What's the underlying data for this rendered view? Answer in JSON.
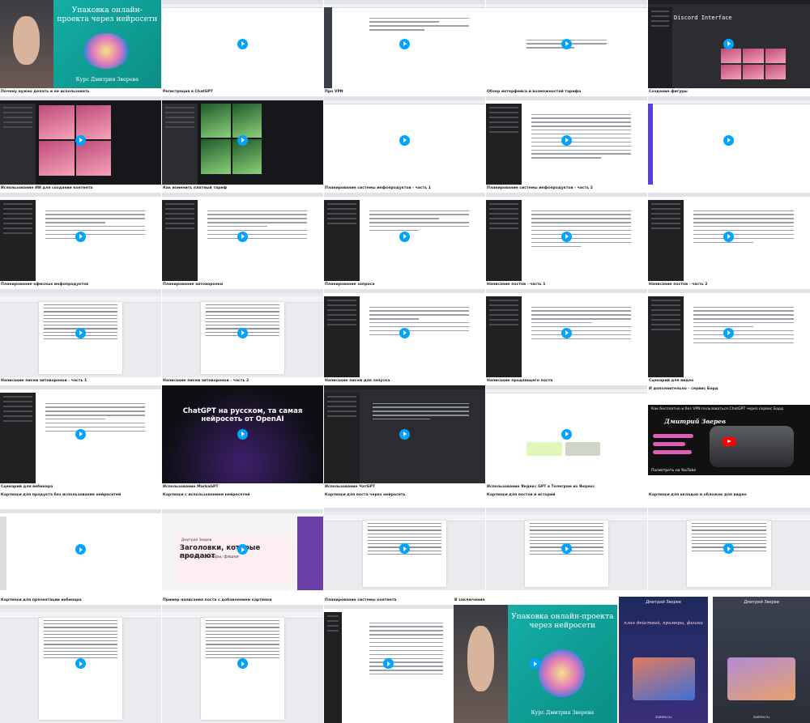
{
  "colors": {
    "accent": "#00a3ff",
    "selection": "#1a5cff",
    "teal": "#16b7ad"
  },
  "hero": {
    "title": "Упаковка онлайн-проекта через нейросети",
    "subtitle": "Курс Дмитрия Зверева"
  },
  "captions": {
    "c00": "Почему нужно делать и не использовать",
    "c01": "Регистрация в ChatGPT",
    "c02": "Про VPN",
    "c03": "Обзор интерфейса и возможностей тарифа",
    "c04": "Создание фигуры",
    "c10": "Использование ИИ для создания контента",
    "c11": "Как изменить платный тариф",
    "c12": "Планирование системы инфопродуктов - часть 1",
    "c13": "Планирование системы инфопродуктов - часть 2",
    "c14": "",
    "c20": "Планирование офисных инфопродуктов",
    "c21": "Планирование автоворонки",
    "c22": "Планирование запроса",
    "c23": "Написание постов - часть 1",
    "c24": "Написание постов - часть 2",
    "c30": "Написание писем автоворонки - часть 1",
    "c31": "Написание писем автоворонки - часть 2",
    "c32": "Написание писем для запуска",
    "c33": "Написание продающего поста",
    "c34": "Сценарий для видео",
    "c40": "Сценарий для вебинара",
    "c41": "Использование MarkaGPT",
    "c42": "Использование ЧатGPT",
    "c43": "Использование Яндекс GPT в Телеграм из Яндекс",
    "c44": "И дополнительно – сервис Бард",
    "c50": "Картинки для продукта без использования нейросетей",
    "c51": "Картинки с использованием нейросетей",
    "c52": "Картинки для поста через нейросеть",
    "c53": "Картинки для постов и историй",
    "c54": "Картинки для вкладок и обложек для видео",
    "c60": "Картинки для презентации вебинара",
    "c61": "Пример написания поста с добавлением картинки",
    "c62": "Планирование системы контента",
    "c63": "В заключение",
    "c64": ""
  },
  "promo": {
    "text": "ChatGPT на русском, та самая нейросеть от OpenAI"
  },
  "youtube": {
    "title": "Как бесплатно и без VPN пользоваться ChatGPT через сервис Бард",
    "name": "Дмитрий Зверев",
    "watch": "Посмотреть на YouTube"
  },
  "headline_card": {
    "author": "Дмитрий Зверев",
    "title": "Заголовки, которые продают",
    "sub": "формулы, примеры, фишки"
  },
  "discord": {
    "title": "Discord Interface"
  },
  "cover1": {
    "author": "Дмитрий Зверев",
    "main": "план действий, примеры, фишки",
    "site": "zverev.ru"
  },
  "cover2": {
    "author": "Дмитрий Зверев",
    "main": "",
    "site": "zverev.ru"
  }
}
